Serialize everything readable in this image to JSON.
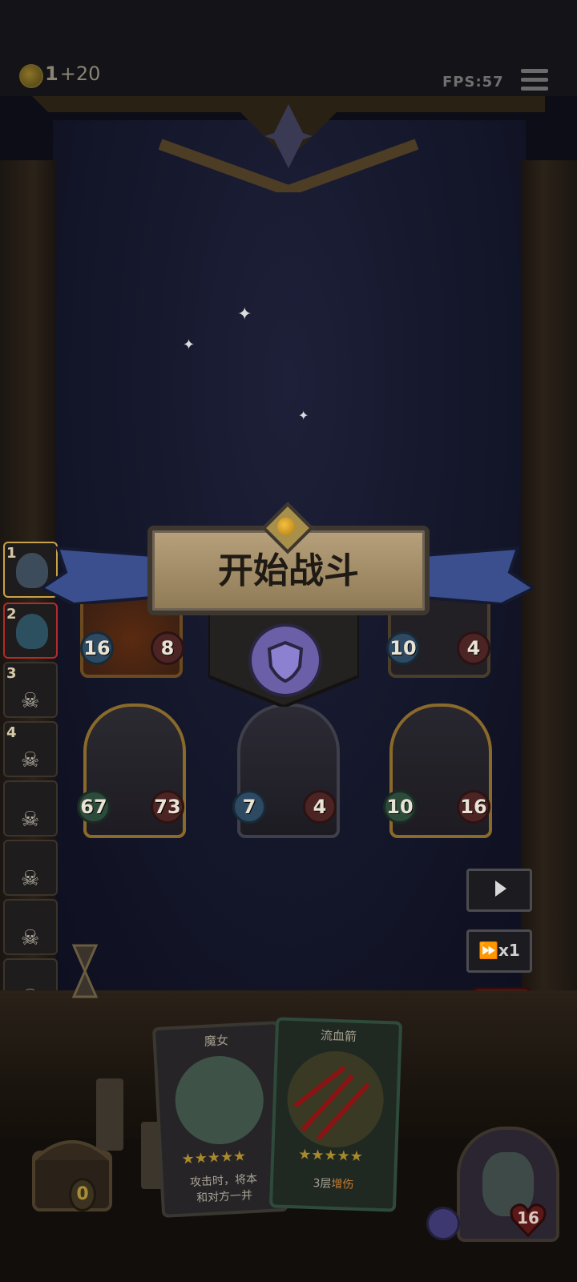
{
  "topbar": {
    "coins": "1",
    "coin_gain": "+20",
    "fps": "FPS:57",
    "menu_icon": "hamburger-menu-icon"
  },
  "banner": {
    "title": "开始战斗",
    "emblem_icon": "shield-icon"
  },
  "queue": [
    {
      "number": "1",
      "type": "portrait",
      "border": "#c8a24a"
    },
    {
      "number": "2",
      "type": "portrait",
      "border": "#b32b2b"
    },
    {
      "number": "3",
      "type": "skull"
    },
    {
      "number": "4",
      "type": "skull"
    },
    {
      "number": "",
      "type": "skull"
    },
    {
      "number": "",
      "type": "skull"
    },
    {
      "number": "",
      "type": "skull"
    },
    {
      "number": "",
      "type": "skull"
    }
  ],
  "board": {
    "row1": [
      {
        "attack": "16",
        "health": "8"
      },
      {
        "attack": "10",
        "health": "4"
      }
    ],
    "row2": [
      {
        "attack": "67",
        "health": "73"
      },
      {
        "attack": "7",
        "health": "4"
      },
      {
        "attack": "10",
        "health": "16"
      }
    ]
  },
  "controls": {
    "play_icon": "play-icon",
    "speed_label": "x1",
    "power_icon": "power-icon"
  },
  "hand": [
    {
      "title": "魔女",
      "stars": "★★★★★",
      "desc_line1": "攻击时，将本",
      "desc_line2": "和对方一并"
    },
    {
      "title": "流血箭",
      "stars": "★★★★★",
      "desc_prefix": "3层",
      "desc_keyword": "增伤"
    }
  ],
  "chest": {
    "count": "0"
  },
  "hero": {
    "health": "16"
  },
  "colors": {
    "accent_gold": "#c8a24a",
    "banner_blue": "#3b4f8f",
    "keyword_orange": "#c77a2c"
  }
}
